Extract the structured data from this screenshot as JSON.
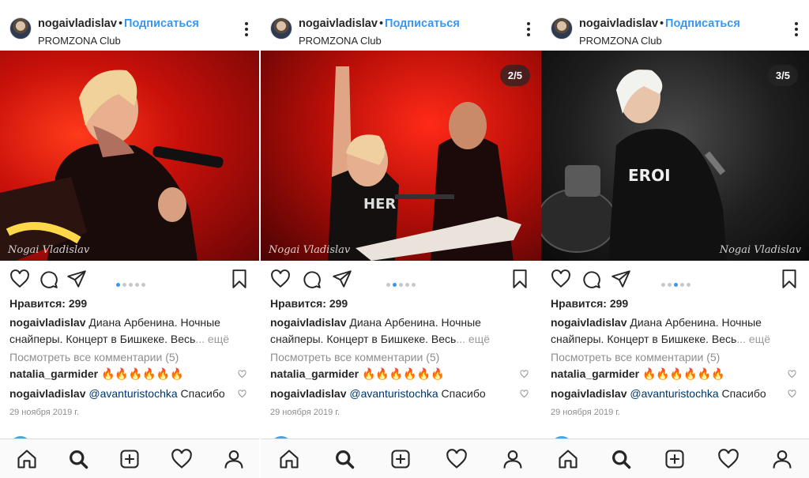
{
  "posts": [
    {
      "username": "nogaivladislav",
      "separator": "•",
      "follow_label": "Подписаться",
      "location": "PROMZONA Club",
      "counter": "",
      "watermark": "Nogai Vladislav",
      "likes": "Нравится: 299",
      "caption_user": "nogaivladislav",
      "caption_text": "Диана Арбенина. Ночные снайперы. Концерт в Бишкеке. Весь",
      "caption_more": "... ещё",
      "view_all": "Посмотреть все комментарии (5)",
      "comments": [
        {
          "user": "natalia_garmider",
          "text": "🔥🔥🔥🔥🔥🔥"
        },
        {
          "user": "nogaivladislav",
          "mention": "@avanturistochka",
          "text": "Спасибо"
        }
      ],
      "date": "29 ноября 2019 г.",
      "carousel_active": 0
    },
    {
      "username": "nogaivladislav",
      "separator": "•",
      "follow_label": "Подписаться",
      "location": "PROMZONA Club",
      "counter": "2/5",
      "watermark": "Nogai Vladislav",
      "likes": "Нравится: 299",
      "caption_user": "nogaivladislav",
      "caption_text": "Диана Арбенина. Ночные снайперы. Концерт в Бишкеке. Весь",
      "caption_more": "... ещё",
      "view_all": "Посмотреть все комментарии (5)",
      "comments": [
        {
          "user": "natalia_garmider",
          "text": "🔥🔥🔥🔥🔥🔥"
        },
        {
          "user": "nogaivladislav",
          "mention": "@avanturistochka",
          "text": "Спасибо"
        }
      ],
      "date": "29 ноября 2019 г.",
      "carousel_active": 1
    },
    {
      "username": "nogaivladislav",
      "separator": "•",
      "follow_label": "Подписаться",
      "location": "PROMZONA Club",
      "counter": "3/5",
      "watermark": "Nogai Vladislav",
      "likes": "Нравится: 299",
      "caption_user": "nogaivladislav",
      "caption_text": "Диана Арбенина. Ночные снайперы. Концерт в Бишкеке. Весь",
      "caption_more": "... ещё",
      "view_all": "Посмотреть все комментарии (5)",
      "comments": [
        {
          "user": "natalia_garmider",
          "text": "🔥🔥🔥🔥🔥🔥"
        },
        {
          "user": "nogaivladislav",
          "mention": "@avanturistochka",
          "text": "Спасибо"
        }
      ],
      "date": "29 ноября 2019 г.",
      "carousel_active": 2
    }
  ],
  "carousel_count": 5,
  "tabbar": [
    "home-icon",
    "search-icon",
    "add-post-icon",
    "activity-heart-icon",
    "profile-icon"
  ],
  "colors": {
    "link": "#3897f0",
    "mention": "#003569",
    "muted": "#8e8e8e",
    "text": "#262626"
  }
}
